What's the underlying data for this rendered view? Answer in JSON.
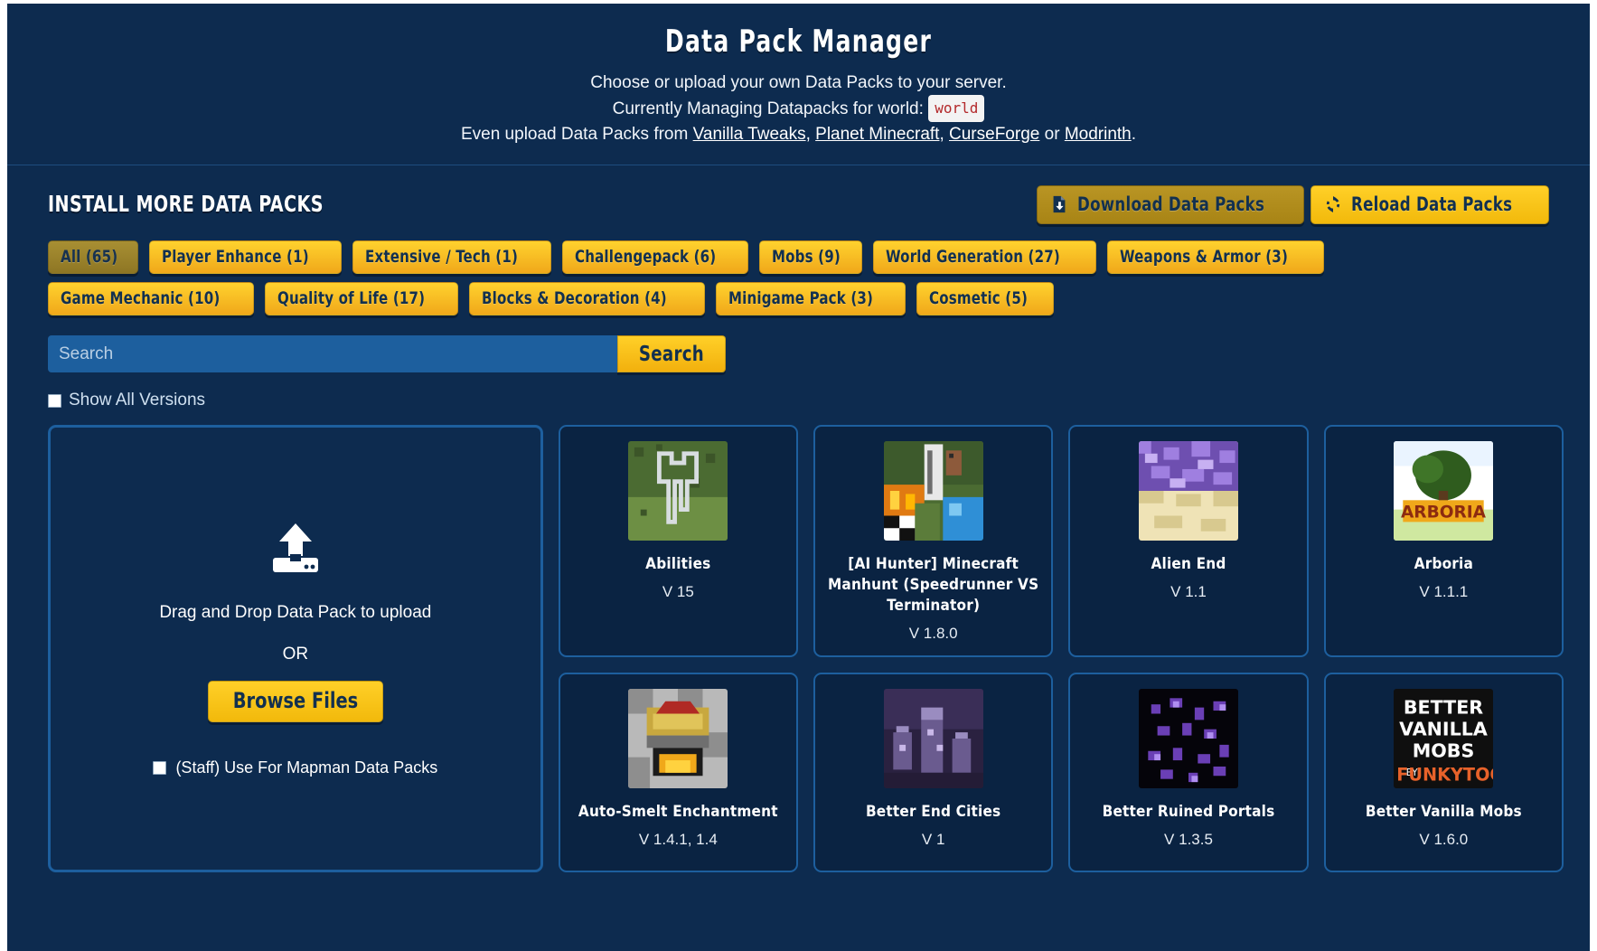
{
  "header": {
    "title": "Data Pack Manager",
    "line1": "Choose or upload your own Data Packs to your server.",
    "line2_prefix": "Currently Managing Datapacks for world:",
    "world": "world",
    "line3_prefix": "Even upload Data Packs from",
    "links": [
      "Vanilla Tweaks",
      "Planet Minecraft",
      "CurseForge",
      "Modrinth"
    ],
    "line3_sep1": ",",
    "line3_sep2": ",",
    "line3_or": "or",
    "line3_end": "."
  },
  "section": {
    "title": "INSTALL MORE DATA PACKS",
    "download_label": "Download Data Packs",
    "reload_label": "Reload Data Packs"
  },
  "categories": [
    {
      "label": "All (65)",
      "active": true
    },
    {
      "label": "Player Enhance (1)",
      "active": false
    },
    {
      "label": "Extensive / Tech (1)",
      "active": false
    },
    {
      "label": "Challengepack (6)",
      "active": false
    },
    {
      "label": "Mobs (9)",
      "active": false
    },
    {
      "label": "World Generation (27)",
      "active": false
    },
    {
      "label": "Weapons & Armor (3)",
      "active": false
    },
    {
      "label": "Game Mechanic (10)",
      "active": false
    },
    {
      "label": "Quality of Life (17)",
      "active": false
    },
    {
      "label": "Blocks & Decoration (4)",
      "active": false
    },
    {
      "label": "Minigame Pack (3)",
      "active": false
    },
    {
      "label": "Cosmetic (5)",
      "active": false
    }
  ],
  "search": {
    "placeholder": "Search",
    "value": "",
    "button_label": "Search"
  },
  "options": {
    "show_all_versions_label": "Show All Versions",
    "show_all_versions_checked": false
  },
  "upload": {
    "drag_text": "Drag and Drop Data Pack to upload",
    "or_text": "OR",
    "browse_label": "Browse Files",
    "staff_label": "(Staff) Use For Mapman Data Packs",
    "staff_checked": false
  },
  "packs": [
    {
      "name": "Abilities",
      "version": "V 15",
      "thumb": "map-outline"
    },
    {
      "name": "[AI Hunter] Minecraft Manhunt (Speedrunner VS Terminator)",
      "version": "V 1.8.0",
      "thumb": "manhunt"
    },
    {
      "name": "Alien End",
      "version": "V 1.1",
      "thumb": "alien-end"
    },
    {
      "name": "Arboria",
      "version": "V 1.1.1",
      "thumb": "arboria"
    },
    {
      "name": "Auto-Smelt Enchantment",
      "version": "V 1.4.1, 1.4",
      "thumb": "autosmelt"
    },
    {
      "name": "Better End Cities",
      "version": "V 1",
      "thumb": "end-cities"
    },
    {
      "name": "Better Ruined Portals",
      "version": "V 1.3.5",
      "thumb": "ruined-portals"
    },
    {
      "name": "Better Vanilla Mobs",
      "version": "V 1.6.0",
      "thumb": "better-vanilla-mobs"
    }
  ],
  "colors": {
    "background": "#0d2b4f",
    "accent_yellow": "#ffd028",
    "accent_gold_active": "#a88f33",
    "card_border": "#1d5f9e",
    "search_field": "#1d5f9e",
    "code_red": "#b3292b"
  }
}
